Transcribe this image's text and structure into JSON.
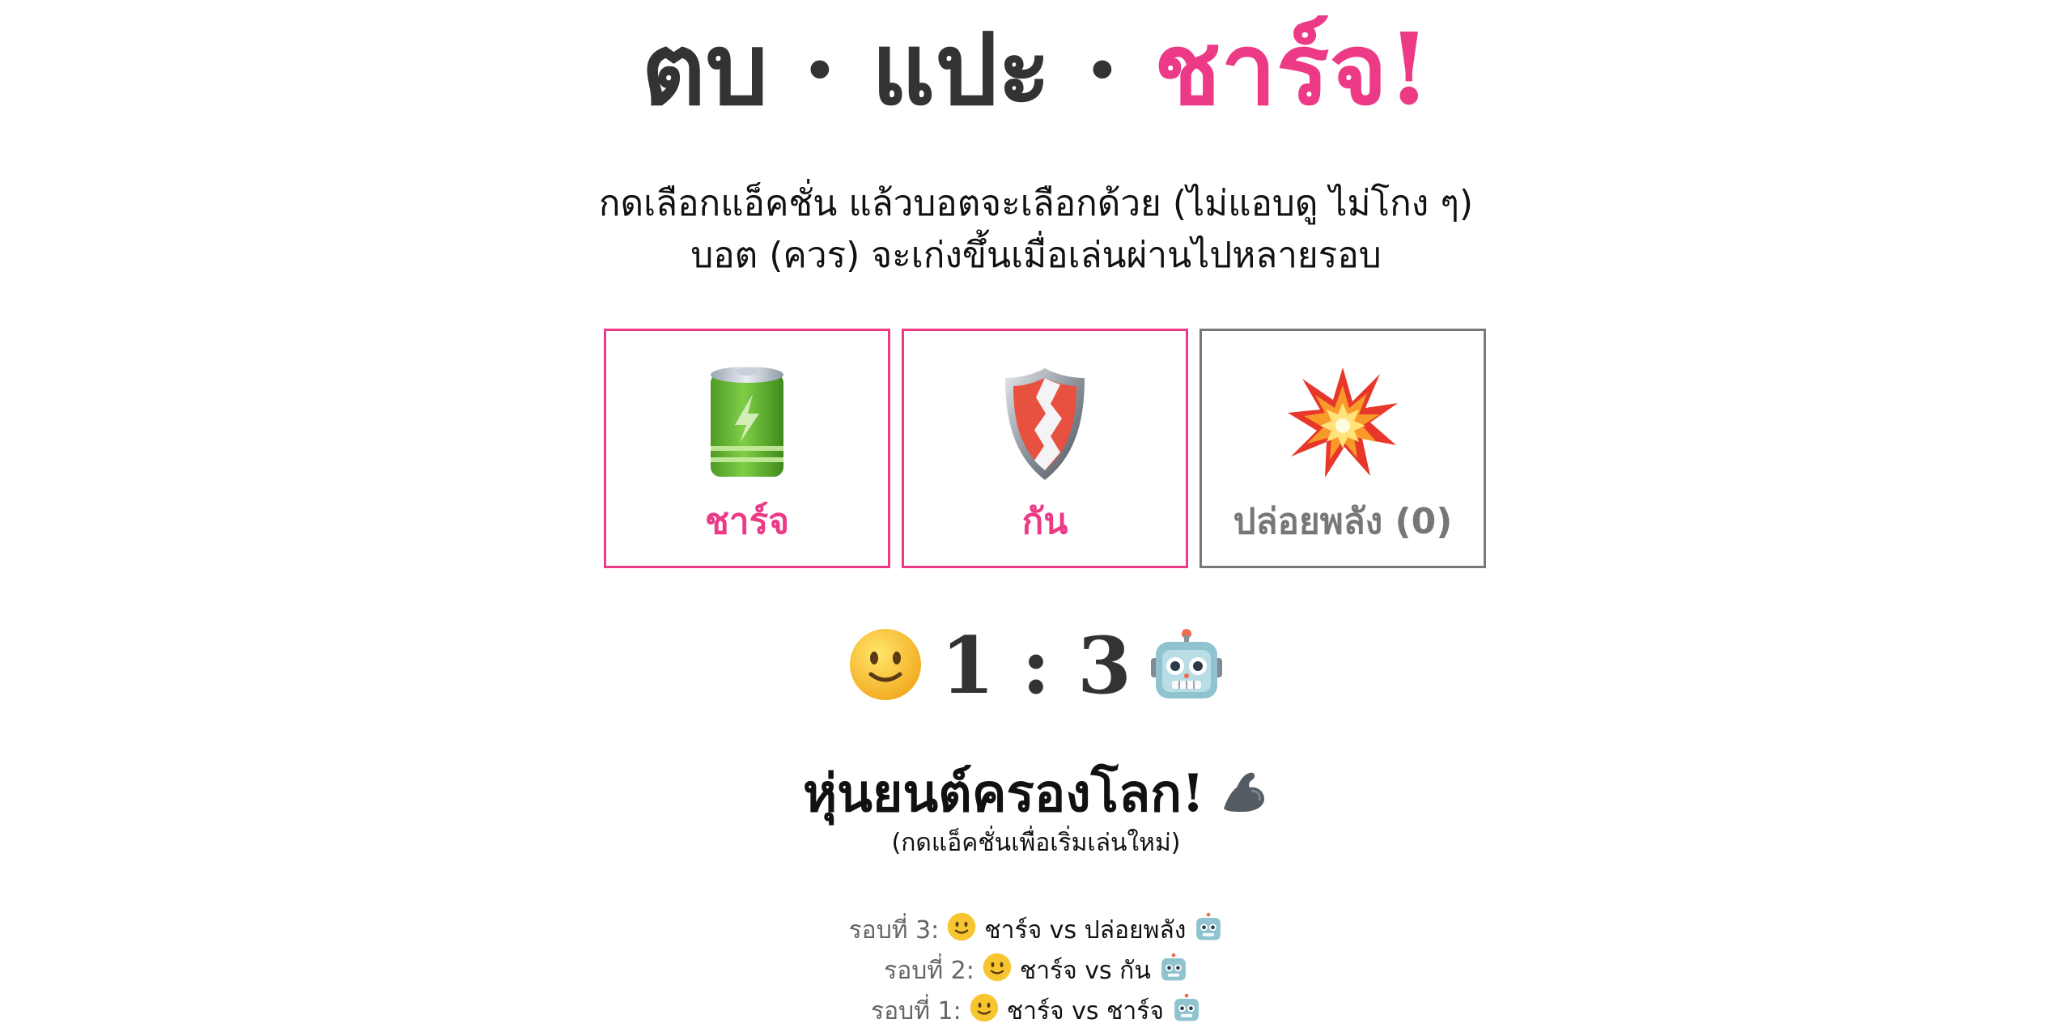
{
  "title": {
    "part1": "ตบ · แปะ · ",
    "part2": "ชาร์จ!"
  },
  "subtitle": {
    "line1": "กดเลือกแอ็คชั่น แล้วบอตจะเลือกด้วย (ไม่แอบดู ไม่โกง ๆ)",
    "line2": "บอต (ควร) จะเก่งขึ้นเมื่อเล่นผ่านไปหลายรอบ"
  },
  "actions": [
    {
      "label": "ชาร์จ",
      "icon": "battery-icon",
      "enabled": true
    },
    {
      "label": "กัน",
      "icon": "shield-icon",
      "enabled": true
    },
    {
      "label": "ปล่อยพลัง (0)",
      "icon": "explosion-icon",
      "enabled": false
    }
  ],
  "score": {
    "player_icon": "smiley-icon",
    "text": "1 : 3",
    "bot_icon": "robot-icon"
  },
  "result": {
    "text": "หุ่นยนต์ครองโลก!",
    "icon": "flexed-arm-icon",
    "hint": "(กดแอ็คชั่นเพื่อเริ่มเล่นใหม่)"
  },
  "history": [
    {
      "round": "รอบที่ 3:",
      "matchup": "ชาร์จ vs ปล่อยพลัง"
    },
    {
      "round": "รอบที่ 2:",
      "matchup": "ชาร์จ vs กัน"
    },
    {
      "round": "รอบที่ 1:",
      "matchup": "ชาร์จ vs ชาร์จ"
    }
  ],
  "colors": {
    "accent": "#ec3a86",
    "disabled": "#777777",
    "title_dark": "#333333"
  }
}
